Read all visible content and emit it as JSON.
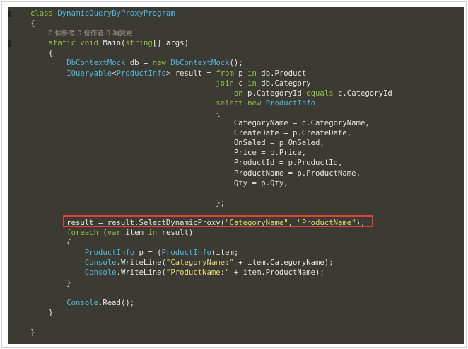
{
  "colors": {
    "background": "#3b3a33",
    "keyword": "#8fc045",
    "type": "#52b6dc",
    "string": "#e6d774",
    "text": "#e3e3e3",
    "highlight_border": "#e0403c"
  },
  "code_lines": [
    [
      [
        "k",
        "class"
      ],
      [
        "p",
        " "
      ],
      [
        "t",
        "DynamicQueryByProxyProgram"
      ]
    ],
    [
      [
        "p",
        "{"
      ]
    ],
    [
      [
        "p",
        "    "
      ],
      [
        "h",
        "0 個參考|0 位作者|0 項變更"
      ]
    ],
    [
      [
        "p",
        "    "
      ],
      [
        "k",
        "static"
      ],
      [
        "p",
        " "
      ],
      [
        "k",
        "void"
      ],
      [
        "p",
        " Main("
      ],
      [
        "k",
        "string"
      ],
      [
        "p",
        "[] args)"
      ]
    ],
    [
      [
        "p",
        "    {"
      ]
    ],
    [
      [
        "p",
        "        "
      ],
      [
        "t",
        "DbContextMock"
      ],
      [
        "p",
        " db = "
      ],
      [
        "k",
        "new"
      ],
      [
        "p",
        " "
      ],
      [
        "t",
        "DbContextMock"
      ],
      [
        "p",
        "();"
      ]
    ],
    [
      [
        "p",
        "        "
      ],
      [
        "t",
        "IQueryable"
      ],
      [
        "p",
        "<"
      ],
      [
        "t",
        "ProductInfo"
      ],
      [
        "p",
        "> result = "
      ],
      [
        "k",
        "from"
      ],
      [
        "p",
        " p "
      ],
      [
        "k",
        "in"
      ],
      [
        "p",
        " db.Product"
      ]
    ],
    [
      [
        "p",
        "                                         "
      ],
      [
        "k",
        "join"
      ],
      [
        "p",
        " c "
      ],
      [
        "k",
        "in"
      ],
      [
        "p",
        " db.Category"
      ]
    ],
    [
      [
        "p",
        "                                             "
      ],
      [
        "k",
        "on"
      ],
      [
        "p",
        " p.CategoryId "
      ],
      [
        "k",
        "equals"
      ],
      [
        "p",
        " c.CategoryId"
      ]
    ],
    [
      [
        "p",
        "                                         "
      ],
      [
        "k",
        "select"
      ],
      [
        "p",
        " "
      ],
      [
        "k",
        "new"
      ],
      [
        "p",
        " "
      ],
      [
        "t",
        "ProductInfo"
      ]
    ],
    [
      [
        "p",
        "                                         {"
      ]
    ],
    [
      [
        "p",
        "                                             CategoryName = c.CategoryName,"
      ]
    ],
    [
      [
        "p",
        "                                             CreateDate = p.CreateDate,"
      ]
    ],
    [
      [
        "p",
        "                                             OnSaled = p.OnSaled,"
      ]
    ],
    [
      [
        "p",
        "                                             Price = p.Price,"
      ]
    ],
    [
      [
        "p",
        "                                             ProductId = p.ProductId,"
      ]
    ],
    [
      [
        "p",
        "                                             ProductName = p.ProductName,"
      ]
    ],
    [
      [
        "p",
        "                                             Qty = p.Qty,"
      ]
    ],
    [
      [
        "p",
        ""
      ]
    ],
    [
      [
        "p",
        "                                         };"
      ]
    ],
    [
      [
        "p",
        ""
      ]
    ],
    [
      [
        "p",
        "        result = result.SelectDynamicProxy("
      ],
      [
        "s",
        "\"CategoryName\""
      ],
      [
        "p",
        ", "
      ],
      [
        "s",
        "\"ProductName\""
      ],
      [
        "p",
        ");"
      ]
    ],
    [
      [
        "p",
        "        "
      ],
      [
        "k",
        "foreach"
      ],
      [
        "p",
        " ("
      ],
      [
        "k",
        "var"
      ],
      [
        "p",
        " item "
      ],
      [
        "k",
        "in"
      ],
      [
        "p",
        " result)"
      ]
    ],
    [
      [
        "p",
        "        {"
      ]
    ],
    [
      [
        "p",
        "            "
      ],
      [
        "t",
        "ProductInfo"
      ],
      [
        "p",
        " p = ("
      ],
      [
        "t",
        "ProductInfo"
      ],
      [
        "p",
        ")item;"
      ]
    ],
    [
      [
        "p",
        "            "
      ],
      [
        "t",
        "Console"
      ],
      [
        "p",
        ".WriteLine("
      ],
      [
        "s",
        "\"CategoryName:\""
      ],
      [
        "p",
        " + item.CategoryName);"
      ]
    ],
    [
      [
        "p",
        "            "
      ],
      [
        "t",
        "Console"
      ],
      [
        "p",
        ".WriteLine("
      ],
      [
        "s",
        "\"ProductName:\""
      ],
      [
        "p",
        " + item.ProductName);"
      ]
    ],
    [
      [
        "p",
        "        }"
      ]
    ],
    [
      [
        "p",
        ""
      ]
    ],
    [
      [
        "p",
        "        "
      ],
      [
        "t",
        "Console"
      ],
      [
        "p",
        ".Read();"
      ]
    ],
    [
      [
        "p",
        "    }"
      ]
    ],
    [
      [
        "p",
        ""
      ]
    ],
    [
      [
        "p",
        "}"
      ]
    ]
  ]
}
